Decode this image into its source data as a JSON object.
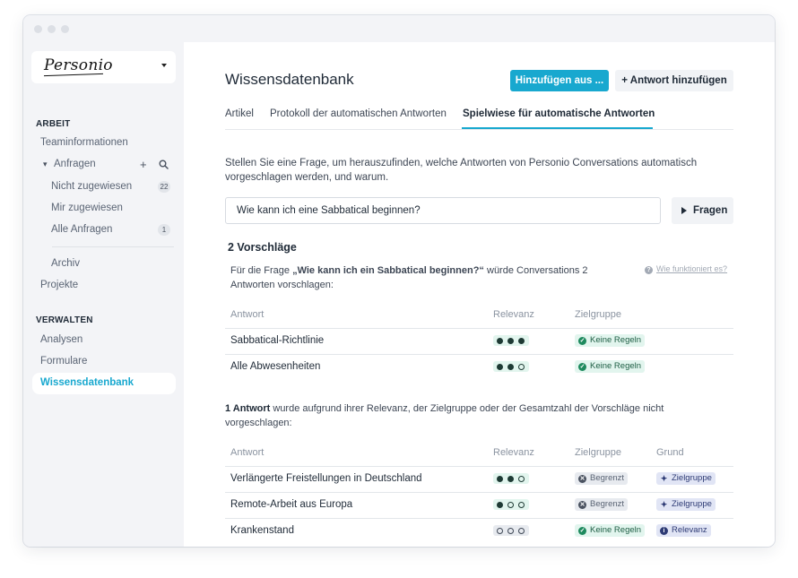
{
  "brand": {
    "logo_text": "Personio"
  },
  "sidebar": {
    "section_work": "ARBEIT",
    "team_info": "Teaminformationen",
    "requests": "Anfragen",
    "unassigned": "Nicht zugewiesen",
    "unassigned_count": "22",
    "assigned_to_me": "Mir zugewiesen",
    "all_requests": "Alle Anfragen",
    "all_requests_count": "1",
    "archive": "Archiv",
    "projects": "Projekte",
    "section_manage": "VERWALTEN",
    "analyses": "Analysen",
    "forms": "Formulare",
    "knowledge_base": "Wissensdatenbank"
  },
  "header": {
    "title": "Wissensdatenbank",
    "add_from_label": "Hinzufügen aus ...",
    "add_answer_label": "+ Antwort hinzufügen"
  },
  "tabs": [
    {
      "label": "Artikel"
    },
    {
      "label": "Protokoll der automatischen Antworten"
    },
    {
      "label": "Spielwiese für automatische Antworten"
    }
  ],
  "playground": {
    "description": "Stellen Sie eine Frage, um herauszufinden, welche Antworten von Personio Conversations automatisch vorgeschlagen werden, und warum.",
    "question_value": "Wie kann ich eine Sabbatical beginnen?",
    "ask_label": "Fragen"
  },
  "suggestions": {
    "heading": "2 Vorschläge",
    "intro_prefix": "Für die Frage ",
    "intro_question": "„Wie kann ich ein Sabbatical beginnen?“",
    "intro_suffix": " würde Conversations 2 Antworten vorschlagen:",
    "help_link": "Wie funktioniert es?",
    "columns": {
      "answer": "Antwort",
      "relevance": "Relevanz",
      "audience": "Zielgruppe"
    },
    "rows": [
      {
        "answer": "Sabbatical-Richtlinie",
        "relevance": 3,
        "audience": "Keine Regeln"
      },
      {
        "answer": "Alle Abwesenheiten",
        "relevance": 2,
        "audience": "Keine Regeln"
      }
    ]
  },
  "not_suggested": {
    "note_bold": "1 Antwort",
    "note_rest": " wurde aufgrund ihrer Relevanz, der Zielgruppe oder der Gesamtzahl der Vorschläge nicht vorgeschlagen:",
    "columns": {
      "answer": "Antwort",
      "relevance": "Relevanz",
      "audience": "Zielgruppe",
      "reason": "Grund"
    },
    "rows": [
      {
        "answer": "Verlängerte Freistellungen in Deutschland",
        "relevance": 2,
        "audience": "Begrenzt",
        "reason": "Zielgruppe"
      },
      {
        "answer": "Remote-Arbeit aus Europa",
        "relevance": 1,
        "audience": "Begrenzt",
        "reason": "Zielgruppe"
      },
      {
        "answer": "Krankenstand",
        "relevance": 0,
        "audience": "Keine Regeln",
        "reason": "Relevanz"
      }
    ]
  },
  "colors": {
    "accent": "#18a8cf",
    "sidebar_bg": "#f3f4f7",
    "relevance_dot": "#1e3a34",
    "tag_green_bg": "#e2f5ee",
    "tag_grey_bg": "#e7eaef",
    "tag_blue_bg": "#e1e5f5"
  }
}
